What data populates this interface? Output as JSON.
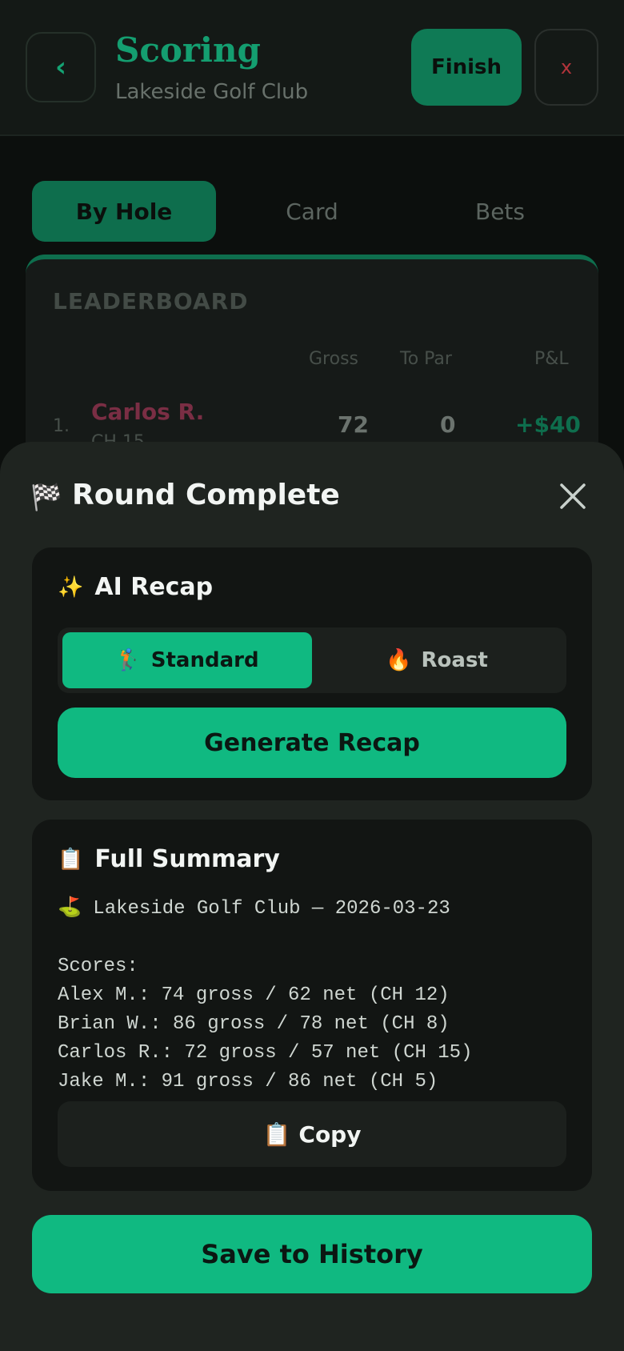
{
  "header": {
    "back_icon": "chevron-left-icon",
    "title": "Scoring",
    "subtitle": "Lakeside Golf Club",
    "finish_label": "Finish",
    "close_label": "x"
  },
  "tabs": [
    {
      "label": "By Hole",
      "active": true
    },
    {
      "label": "Card",
      "active": false
    },
    {
      "label": "Bets",
      "active": false
    }
  ],
  "leaderboard": {
    "title": "LEADERBOARD",
    "columns": [
      "Gross",
      "To Par",
      "P&L"
    ],
    "rows": [
      {
        "rank": "1.",
        "name": "Carlos R.",
        "ch": "CH 15",
        "gross": "72",
        "to_par": "0",
        "pl": "+$40"
      }
    ]
  },
  "sheet": {
    "title_icon": "🏁",
    "title": "Round Complete",
    "close_icon": "close-icon",
    "ai_recap": {
      "icon": "✨",
      "title": "AI Recap",
      "modes": [
        {
          "icon": "🏌️",
          "label": "Standard",
          "selected": true
        },
        {
          "icon": "🔥",
          "label": "Roast",
          "selected": false
        }
      ],
      "generate_label": "Generate Recap"
    },
    "summary": {
      "icon": "📋",
      "title": "Full Summary",
      "lines": [
        "⛳ Lakeside Golf Club — 2026-03-23",
        "",
        "Scores:",
        "Alex M.: 74 gross / 62 net (CH 12)",
        "Brian W.: 86 gross / 78 net (CH 8)",
        "Carlos R.: 72 gross / 57 net (CH 15)",
        "Jake M.: 91 gross / 86 net (CH 5)"
      ],
      "copy_icon": "📋",
      "copy_label": "Copy"
    },
    "save_label": "Save to History"
  },
  "colors": {
    "accent": "#10b981",
    "background": "#0c0f0d",
    "sheet": "#1f2420",
    "card": "#121513"
  }
}
